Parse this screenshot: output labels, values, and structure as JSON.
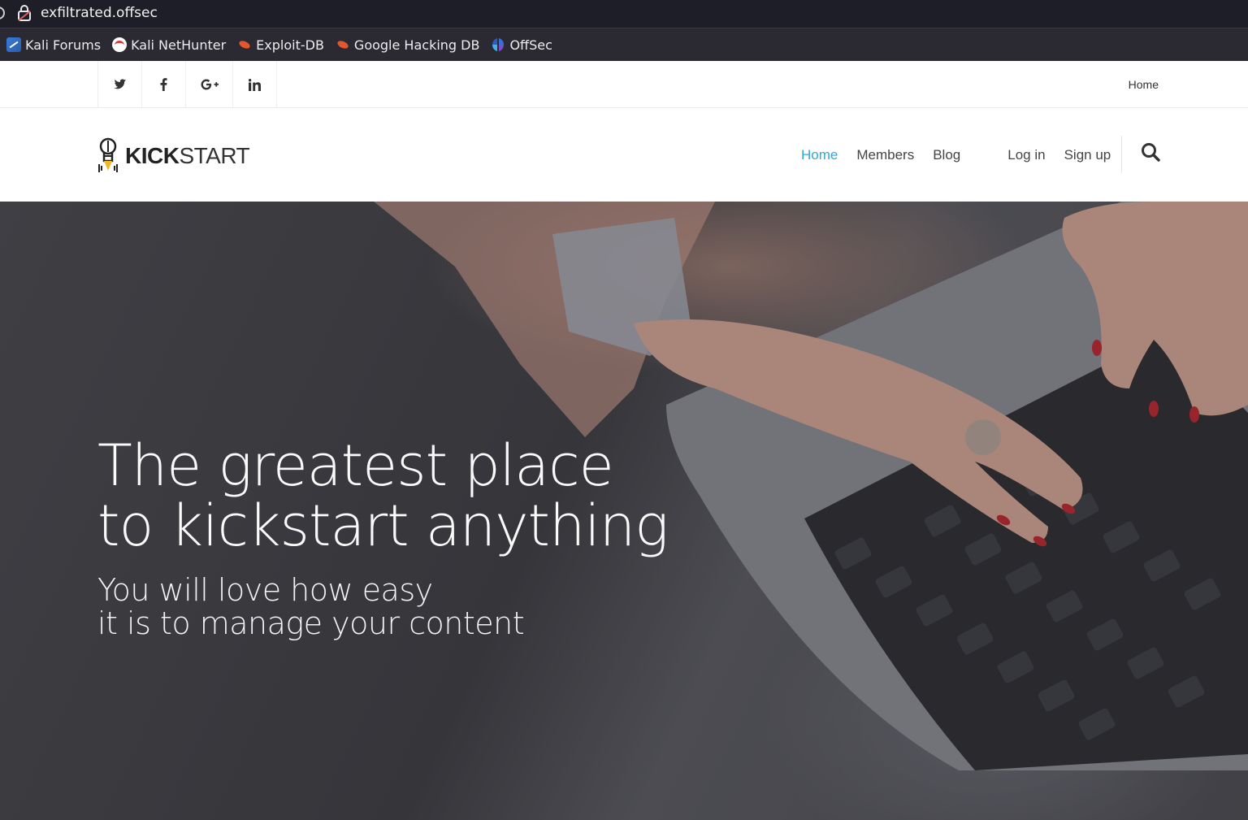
{
  "browser": {
    "url": "exfiltrated.offsec",
    "bookmarks": [
      {
        "label": "Kali Forums",
        "icon": "kali-forums-icon"
      },
      {
        "label": "Kali NetHunter",
        "icon": "kali-nethunter-icon"
      },
      {
        "label": "Exploit-DB",
        "icon": "exploit-db-icon"
      },
      {
        "label": "Google Hacking DB",
        "icon": "exploit-db-icon"
      },
      {
        "label": "OffSec",
        "icon": "offsec-icon"
      }
    ]
  },
  "topbar": {
    "social": [
      {
        "name": "twitter",
        "glyph": "🐦"
      },
      {
        "name": "facebook",
        "glyph": "f"
      },
      {
        "name": "google-plus",
        "glyph": "G+"
      },
      {
        "name": "linkedin",
        "glyph": "in"
      }
    ],
    "home_link": "Home"
  },
  "navbar": {
    "logo_bold": "KICK",
    "logo_light": "START",
    "menu": {
      "home": "Home",
      "members": "Members",
      "blog": "Blog",
      "login": "Log in",
      "signup": "Sign up"
    }
  },
  "hero": {
    "headline_line1": "The greatest place",
    "headline_line2": "to kickstart anything",
    "sub_line1": "You will love how easy",
    "sub_line2": "it is to manage your content"
  },
  "colors": {
    "accent": "#2fa9d8",
    "url_bar_bg": "#1e1e28",
    "bookmark_bar_bg": "#2b2a33"
  }
}
